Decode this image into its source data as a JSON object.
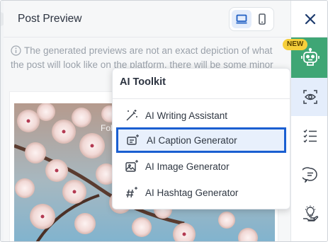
{
  "preview": {
    "title": "Post Preview",
    "notice": "The generated previews are not an exact depiction of what the post will look like on the platform, there will be some minor",
    "image_overlay_text": "Foll",
    "device_toggle": {
      "desktop_icon": "monitor-icon",
      "mobile_icon": "smartphone-icon",
      "selected": "desktop"
    }
  },
  "toolkit": {
    "title": "AI Toolkit",
    "items": [
      {
        "label": "AI Writing Assistant",
        "icon": "magic-wand-icon"
      },
      {
        "label": "AI Caption Generator",
        "icon": "caption-sparkle-icon",
        "selected": true
      },
      {
        "label": "AI Image Generator",
        "icon": "image-sparkle-icon"
      },
      {
        "label": "AI Hashtag Generator",
        "icon": "hashtag-sparkle-icon"
      }
    ]
  },
  "sidebar": {
    "new_badge": "NEW",
    "items": [
      "close-icon",
      "ai-robot-icon",
      "eye-preview-icon",
      "checklist-icon",
      "comment-icon",
      "lightbulb-hand-icon"
    ],
    "active": "eye-preview-icon"
  },
  "colors": {
    "selection_border": "#1a5fd1",
    "selection_fill": "#e8f0fc",
    "ai_slot": "#3fa675",
    "badge": "#f6cf3b",
    "accent_blue": "#1f5fc4"
  }
}
